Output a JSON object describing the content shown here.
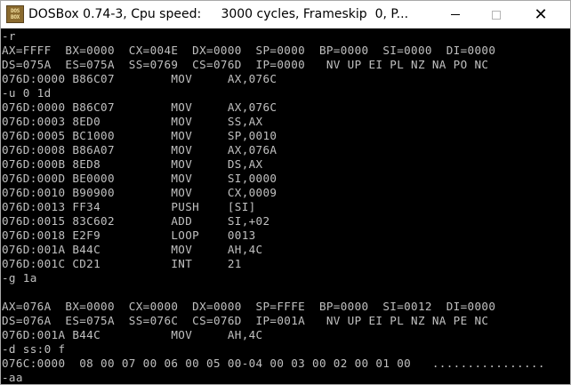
{
  "window": {
    "title": "DOSBox 0.74-3, Cpu speed:     3000 cycles, Frameskip  0, P...",
    "icon_text": "DOS BOX",
    "minimize_icon": "minimize-icon",
    "maximize_icon": "maximize-icon",
    "close_icon": "close-icon",
    "close_glyph": "✕"
  },
  "console": {
    "background": "#000000",
    "text_color": "#c0c0c0",
    "lines": [
      "-r",
      "AX=FFFF  BX=0000  CX=004E  DX=0000  SP=0000  BP=0000  SI=0000  DI=0000",
      "DS=075A  ES=075A  SS=0769  CS=076D  IP=0000   NV UP EI PL NZ NA PO NC",
      "076D:0000 B86C07        MOV     AX,076C",
      "-u 0 1d",
      "076D:0000 B86C07        MOV     AX,076C",
      "076D:0003 8ED0          MOV     SS,AX",
      "076D:0005 BC1000        MOV     SP,0010",
      "076D:0008 B86A07        MOV     AX,076A",
      "076D:000B 8ED8          MOV     DS,AX",
      "076D:000D BE0000        MOV     SI,0000",
      "076D:0010 B90900        MOV     CX,0009",
      "076D:0013 FF34          PUSH    [SI]",
      "076D:0015 83C602        ADD     SI,+02",
      "076D:0018 E2F9          LOOP    0013",
      "076D:001A B44C          MOV     AH,4C",
      "076D:001C CD21          INT     21",
      "-g 1a",
      "",
      "AX=076A  BX=0000  CX=0000  DX=0000  SP=FFFE  BP=0000  SI=0012  DI=0000",
      "DS=076A  ES=075A  SS=076C  CS=076D  IP=001A   NV UP EI PL NZ NA PE NC",
      "076D:001A B44C          MOV     AH,4C",
      "-d ss:0 f",
      "076C:0000  08 00 07 00 06 00 05 00-04 00 03 00 02 00 01 00   ................",
      "-aa"
    ]
  }
}
